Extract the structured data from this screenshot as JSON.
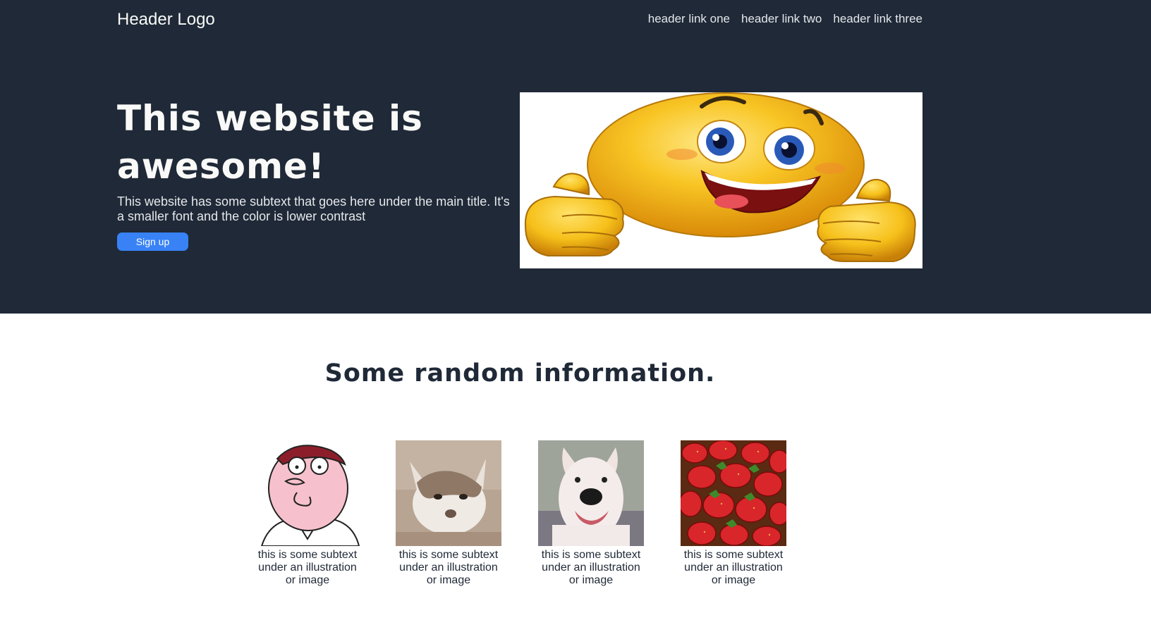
{
  "header": {
    "logo": "Header Logo",
    "links": [
      "header link one",
      "header link two",
      "header link three"
    ]
  },
  "hero": {
    "title": "This website is awesome!",
    "subtext": "This website has some subtext that goes here under the main title. It's a smaller font and the color is lower contrast",
    "signup_label": "Sign up",
    "image_icon": "thumbs-up-smiley-icon"
  },
  "info": {
    "title": "Some random information.",
    "cards": [
      {
        "caption": "this is some subtext under an illustration or image",
        "icon": "cartoon-man-illustration"
      },
      {
        "caption": "this is some subtext under an illustration or image",
        "icon": "cat-photo"
      },
      {
        "caption": "this is some subtext under an illustration or image",
        "icon": "dog-photo"
      },
      {
        "caption": "this is some subtext under an illustration or image",
        "icon": "strawberries-photo"
      }
    ]
  },
  "colors": {
    "hero_bg": "#1f2937",
    "accent": "#3882f6",
    "text_light": "#f9faf8",
    "text_muted": "#e5e7eb"
  }
}
